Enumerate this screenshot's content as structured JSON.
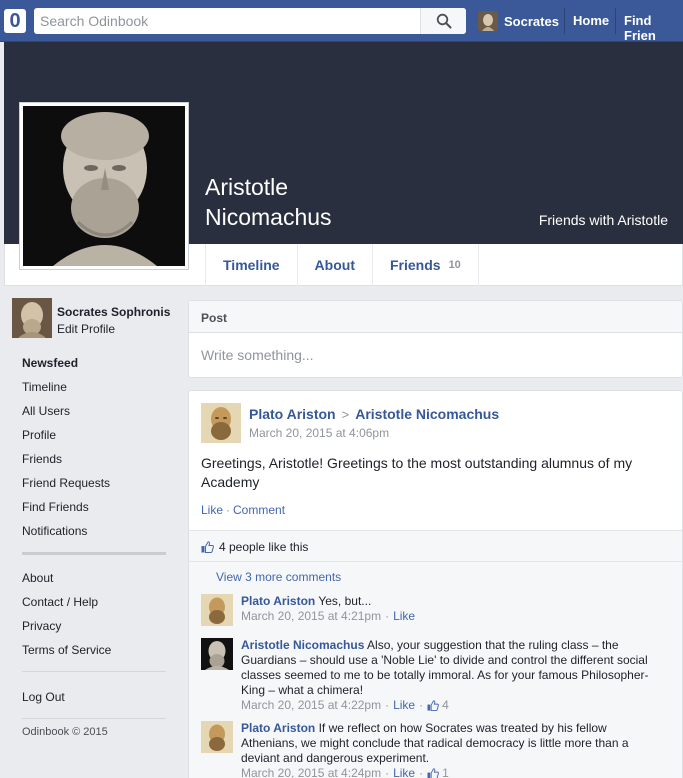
{
  "topbar": {
    "logo": "0",
    "search_placeholder": "Search Odinbook",
    "user_name": "Socrates",
    "home": "Home",
    "find_friends": "Find Frien"
  },
  "profile": {
    "name_line1": "Aristotle",
    "name_line2": "Nicomachus",
    "friends_with": "Friends with Aristotle",
    "tabs": [
      {
        "label": "Timeline"
      },
      {
        "label": "About"
      },
      {
        "label": "Friends",
        "count": "10"
      }
    ]
  },
  "sidebar": {
    "me_name": "Socrates Sophronis",
    "edit_profile": "Edit Profile",
    "main_links": [
      "Newsfeed",
      "Timeline",
      "All Users",
      "Profile",
      "Friends",
      "Friend Requests",
      "Find Friends",
      "Notifications"
    ],
    "info_links": [
      "About",
      "Contact / Help",
      "Privacy",
      "Terms of Service"
    ],
    "logout": "Log Out",
    "copyright": "Odinbook © 2015"
  },
  "composer": {
    "header": "Post",
    "placeholder": "Write something..."
  },
  "post": {
    "author": "Plato Ariston",
    "arrow": ">",
    "target": "Aristotle Nicomachus",
    "time": "March 20, 2015 at 4:06pm",
    "text": "Greetings, Aristotle! Greetings to the most outstanding alumnus of my Academy",
    "like": "Like",
    "comment": "Comment",
    "likes_text": "4 people like this",
    "view_more": "View 3 more comments",
    "comments": [
      {
        "author": "Plato Ariston",
        "text": "Yes, but...",
        "time": "March 20, 2015 at 4:21pm",
        "action": "Like",
        "likes": ""
      },
      {
        "author": "Aristotle Nicomachus",
        "text": "Also, your suggestion that the ruling class – the Guardians – should use a 'Noble Lie' to divide and control the different social classes seemed to me to be totally immoral. As for your famous Philosopher-King – what a chimera!",
        "time": "March 20, 2015 at 4:22pm",
        "action": "Like",
        "likes": "4"
      },
      {
        "author": "Plato Ariston",
        "text": "If we reflect on how Socrates was treated by his fellow Athenians, we might conclude that radical democracy is little more than a deviant and dangerous experiment.",
        "time": "March 20, 2015 at 4:24pm",
        "action": "Like",
        "likes": "1"
      }
    ]
  },
  "colors": {
    "topbar": "#3b5998",
    "link": "#365899",
    "cover": "#2a2f3f",
    "background": "#e9ebee"
  }
}
